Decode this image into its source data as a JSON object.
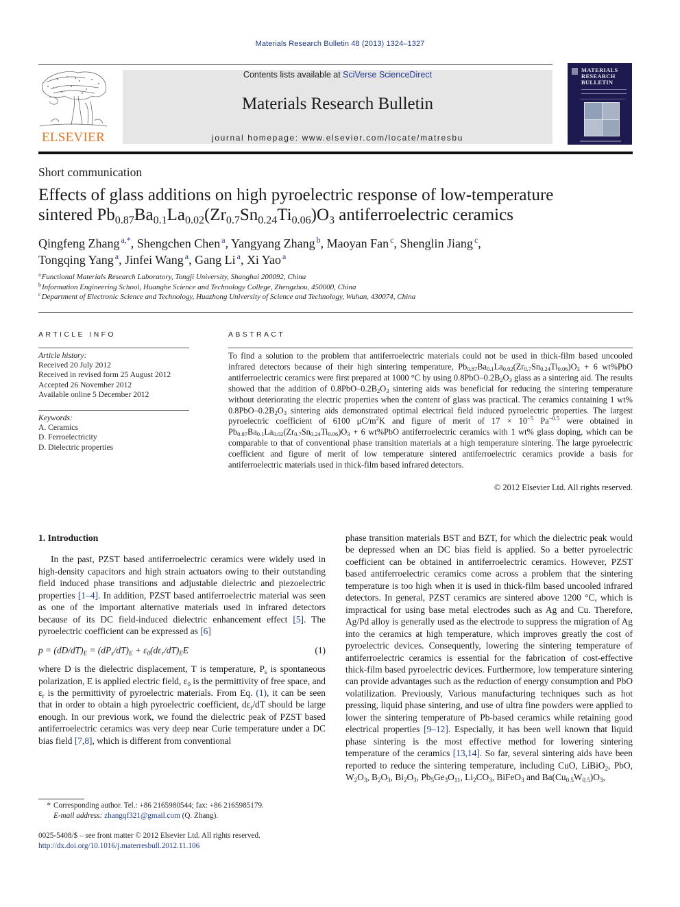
{
  "header": {
    "citation": "Materials Research Bulletin 48 (2013) 1324–1327",
    "contents_prefix": "Contents lists available at ",
    "contents_link": "SciVerse ScienceDirect",
    "journal_name": "Materials Research Bulletin",
    "homepage": "journal homepage: www.elsevier.com/locate/matresbu",
    "publisher_logo_text": "ELSEVIER",
    "cover_title_lines": [
      "MATERIALS",
      "RESEARCH",
      "BULLETIN"
    ]
  },
  "colors": {
    "link": "#1f3a93",
    "elsevier_orange": "#e87722",
    "banner_bg": "#e6e6e6",
    "cover_bg": "#1c1a4e"
  },
  "article": {
    "type": "Short communication",
    "title_line1": "Effects of glass additions on high pyroelectric response of low-temperature",
    "title_line2": {
      "prefix": "sintered Pb",
      "s1": "0.87",
      "t1": "Ba",
      "s2": "0.1",
      "t2": "La",
      "s3": "0.02",
      "t3": "(Zr",
      "s4": "0.7",
      "t4": "Sn",
      "s5": "0.24",
      "t5": "Ti",
      "s6": "0.06",
      "t6": ")O",
      "s7": "3",
      "suffix": " antiferroelectric ceramics"
    },
    "authors": [
      {
        "name": "Qingfeng Zhang",
        "aff": "a,*",
        "sep": ", "
      },
      {
        "name": "Shengchen Chen",
        "aff": "a",
        "sep": ", "
      },
      {
        "name": "Yangyang Zhang",
        "aff": "b",
        "sep": ", "
      },
      {
        "name": "Maoyan Fan",
        "aff": "c",
        "sep": ", "
      },
      {
        "name": "Shenglin Jiang",
        "aff": "c",
        "sep": ","
      },
      {
        "name": "Tongqing Yang",
        "aff": "a",
        "sep": ", "
      },
      {
        "name": "Jinfei Wang",
        "aff": "a",
        "sep": ", "
      },
      {
        "name": "Gang Li",
        "aff": "a",
        "sep": ", "
      },
      {
        "name": "Xi Yao",
        "aff": "a",
        "sep": ""
      }
    ],
    "affiliations": [
      {
        "key": "a",
        "text": "Functional Materials Research Laboratory, Tongji University, Shanghai 200092, China"
      },
      {
        "key": "b",
        "text": "Information Engineering School, Huanghe Science and Technology College, Zhengzhou, 450000, China"
      },
      {
        "key": "c",
        "text": "Department of Electronic Science and Technology, Huazhong University of Science and Technology, Wuhan, 430074, China"
      }
    ]
  },
  "article_info": {
    "label": "ARTICLE INFO",
    "history_label": "Article history:",
    "history": [
      "Received 20 July 2012",
      "Received in revised form 25 August 2012",
      "Accepted 26 November 2012",
      "Available online 5 December 2012"
    ],
    "keywords_label": "Keywords:",
    "keywords": [
      "A. Ceramics",
      "D. Ferroelectricity",
      "D. Dielectric properties"
    ]
  },
  "abstract": {
    "label": "ABSTRACT",
    "p1": "To find a solution to the problem that antiferroelectric materials could not be used in thick-film based uncooled infrared detectors because of their high sintering temperature, ",
    "p2": "O",
    "p3": " + 6 wt%PbO antiferroelectric ceramics were first prepared at 1000 °C by using 0.8PbO–0.2B",
    "p4": " glass as a sintering aid. The results showed that the addition of 0.8PbO–0.2B",
    "p5": " sintering aids was beneficial for reducing the sintering temperature without deteriorating the electric properties when the content of glass was practical. The ceramics containing 1 wt% 0.8PbO–0.2B",
    "p6": " sintering aids demonstrated optimal electrical field induced pyroelectric properties. The largest pyroelectric coefficient of 6100 μC/m",
    "p7": "K and figure of merit of 17 × 10",
    "p8": " Pa",
    "p9": " were obtained in ",
    "p10": " + 6 wt%PbO antiferroelectric ceramics with 1 wt% glass doping, which can be comparable to that of conventional phase transition materials at a high temperature sintering. The large pyroelectric coefficient and figure of merit of low temperature sintered antiferroelectric ceramics provide a basis for antiferroelectric materials used in thick-film based infrared detectors.",
    "formula_a": "Pb<sub>0.87</sub>Ba<sub>0.1</sub>La<sub>0.02</sub>(Zr<sub>0.7</sub>Sn<sub>0.24</sub>Ti<sub>0.06</sub>)",
    "sup_exp1": "−5",
    "sup_exp2": "−0.5",
    "copyright": "© 2012 Elsevier Ltd. All rights reserved."
  },
  "introduction": {
    "heading": "1.  Introduction",
    "para1_a": "In the past, PZST based antiferroelectric ceramics were widely used in high-density capacitors and high strain actuators owing to their outstanding field induced phase transitions and adjustable dielectric and piezoelectric properties ",
    "ref1": "[1–4]",
    "para1_b": ". In addition, PZST based antiferroelectric material was seen as one of the important alternative materials used in infrared detectors because of its DC field-induced dielectric enhancement effect ",
    "ref2": "[5]",
    "para1_c": ". The pyroelectric coefficient can be expressed as ",
    "ref3": "[6]",
    "equation_number": "(1)",
    "para2_a": "where D is the dielectric displacement, T is temperature, P",
    "para2_b": " is spontaneous polarization, E is applied electric field, ε",
    "para2_c": " is the permittivity of free space, and ε",
    "para2_d": " is the permittivity of pyroelectric materials. From Eq. ",
    "ref_eq": "(1)",
    "para2_e": ", it can be seen that in order to obtain a high pyroelectric coefficient, dε",
    "para2_f": "/dT should be large enough. In our previous work, we found the dielectric peak of PZST based antiferroelectric ceramics was very deep near Curie temperature under a DC bias field ",
    "ref4": "[7,8]",
    "para2_g": ", which is different from conventional",
    "right_a": "phase transition materials BST and BZT, for which the dielectric peak would be depressed when an DC bias field is applied. So a better pyroelectric coefficient can be obtained in antiferroelectric ceramics. However, PZST based antiferroelectric ceramics come across a problem that the sintering temperature is too high when it is used in thick-film based uncooled infrared detectors. In general, PZST ceramics are sintered above 1200 °C, which is impractical for using base metal electrodes such as Ag and Cu. Therefore, Ag/Pd alloy is generally used as the electrode to suppress the migration of Ag into the ceramics at high temperature, which improves greatly the cost of pyroelectric devices. Consequently, lowering the sintering temperature of antiferroelectric ceramics is essential for the fabrication of cost-effective thick-film based pyroelectric devices. Furthermore, low temperature sintering can provide advantages such as the reduction of energy consumption and PbO volatilization. Previously, Various manufacturing techniques such as hot pressing, liquid phase sintering, and use of ultra fine powders were applied to lower the sintering temperature of Pb-based ceramics while retaining good electrical properties ",
    "ref5": "[9–12]",
    "right_b": ". Especially, it has been well known that liquid phase sintering is the most effective method for lowering sintering temperature of the ceramics ",
    "ref6": "[13,14]",
    "right_c": ". So far, several sintering aids have been reported to reduce the sintering temperature, including CuO, LiBiO",
    "right_d": ", PbO, W",
    "right_e": "O",
    "right_f": ", B",
    "right_g": "O",
    "right_h": ", Bi",
    "right_i": "O",
    "right_j": ", Pb",
    "right_k": "Ge",
    "right_l": "O",
    "right_m": ", Li",
    "right_n": "CO",
    "right_o": ", BiFeO",
    "right_p": " and Ba(Cu",
    "right_q": "W",
    "right_r": ")O",
    "right_s": ","
  },
  "footnotes": {
    "star": "*",
    "corresponding": "Corresponding author. Tel.: +86 2165980544; fax: +86 2165985179.",
    "email_label": "E-mail address:",
    "email": "zhangqf321@gmail.com",
    "email_suffix": " (Q. Zhang).",
    "issn": "0025-5408/$ – see front matter © 2012 Elsevier Ltd. All rights reserved.",
    "doi": "http://dx.doi.org/10.1016/j.materresbull.2012.11.106"
  }
}
